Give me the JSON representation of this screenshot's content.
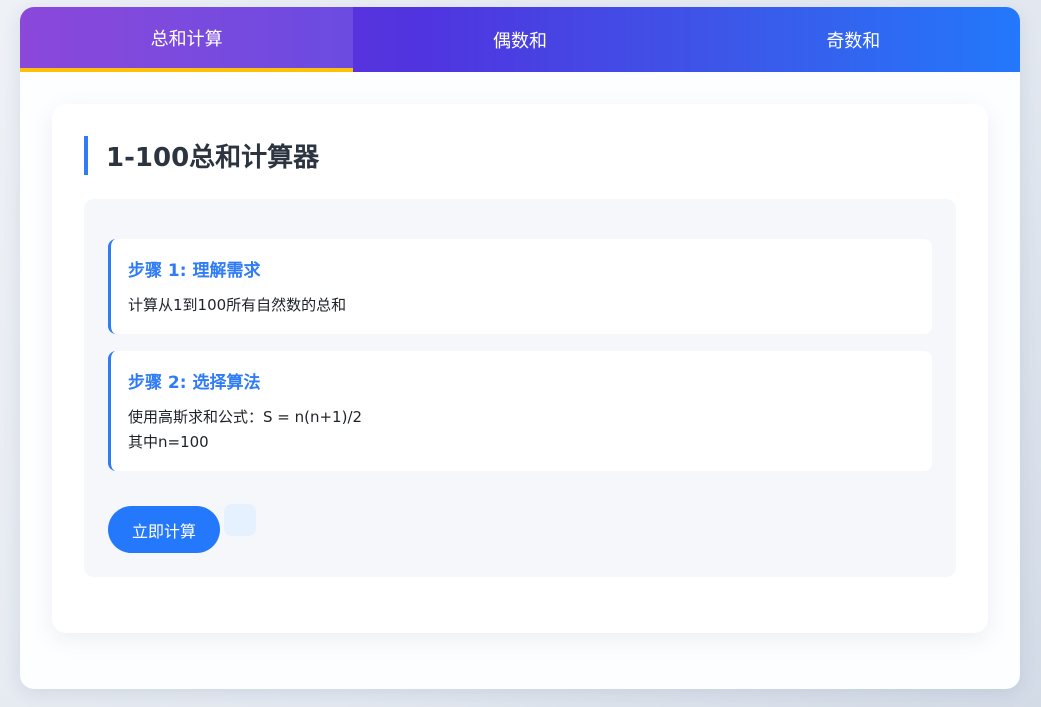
{
  "tabs": [
    {
      "label": "总和计算",
      "active": true
    },
    {
      "label": "偶数和",
      "active": false
    },
    {
      "label": "奇数和",
      "active": false
    }
  ],
  "main": {
    "title": "1-100总和计算器",
    "steps": [
      {
        "title": "步骤 1: 理解需求",
        "lines": [
          "计算从1到100所有自然数的总和"
        ]
      },
      {
        "title": "步骤 2: 选择算法",
        "lines": [
          "使用高斯求和公式：S = n(n+1)/2",
          "其中n=100"
        ]
      }
    ],
    "calculate_label": "立即计算",
    "result": ""
  },
  "colors": {
    "accent": "#2f7cf6",
    "active_tab_indicator": "#ffc107",
    "button": "#2378fb"
  }
}
